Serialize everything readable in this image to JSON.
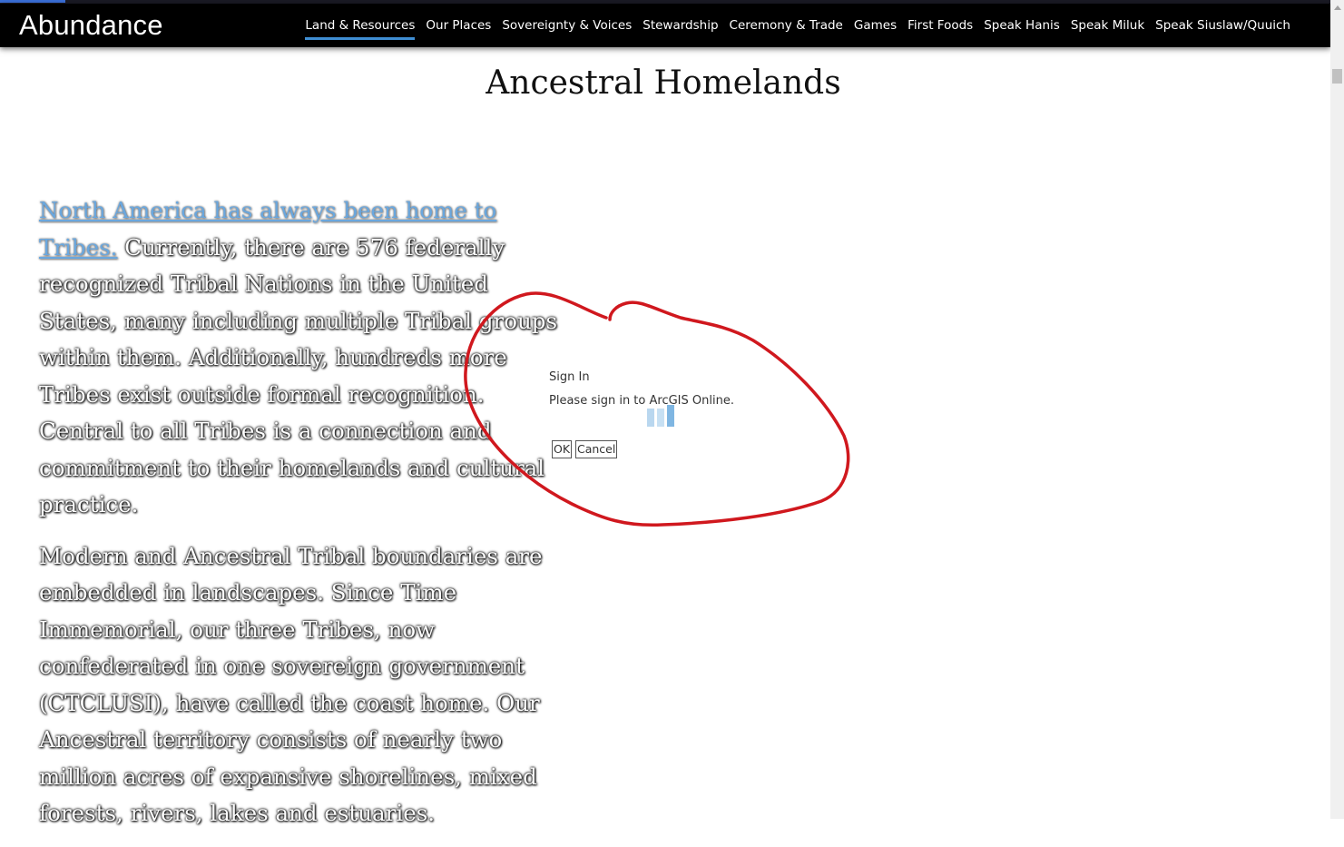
{
  "header": {
    "site_title": "Abundance",
    "nav": [
      {
        "label": "Land & Resources",
        "active": true
      },
      {
        "label": "Our Places"
      },
      {
        "label": "Sovereignty & Voices"
      },
      {
        "label": "Stewardship"
      },
      {
        "label": "Ceremony & Trade"
      },
      {
        "label": "Games"
      },
      {
        "label": "First Foods"
      },
      {
        "label": "Speak Hanis"
      },
      {
        "label": "Speak Miluk"
      },
      {
        "label": "Speak Siuslaw/Quuich"
      }
    ]
  },
  "page": {
    "title": "Ancestral Homelands"
  },
  "story": {
    "p1_link": "North America has always been home to Tribes.",
    "p1_rest": "  Currently, there are 576 federally recognized Tribal Nations in the United States, many including multiple Tribal groups within them.  Additionally, hundreds more Tribes exist outside formal recognition. Central to all Tribes is a connection and commitment to their homelands and cultural practice.",
    "p2": "Modern and Ancestral Tribal boundaries are embedded in landscapes. Since Time Immemorial, our three Tribes, now confederated in one sovereign government (CTCLUSI), have called the coast home. Our Ancestral territory consists of nearly two million acres of expansive shorelines, mixed forests, rivers, lakes and estuaries."
  },
  "dialog": {
    "title": "Sign In",
    "message": "Please sign in to ArcGIS Online.",
    "ok_label": "OK",
    "cancel_label": "Cancel"
  },
  "colors": {
    "header_bg": "#000000",
    "nav_active_underline": "#3f8ed3",
    "link": "#6aa7de",
    "annotation": "#d0181e"
  }
}
